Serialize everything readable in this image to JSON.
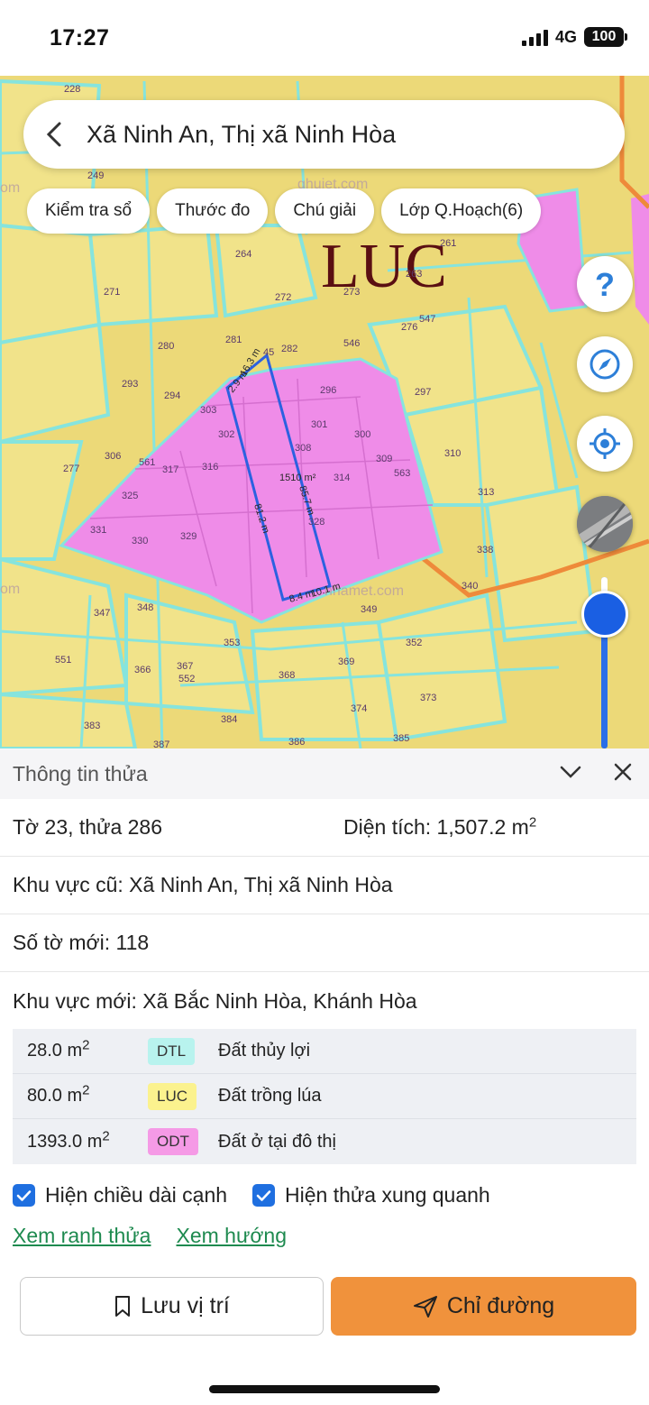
{
  "status_bar": {
    "time": "17:27",
    "network": "4G",
    "battery": "100"
  },
  "search": {
    "title": "Xã Ninh An, Thị xã Ninh Hòa"
  },
  "chips": [
    "Kiểm tra sổ",
    "Thước đo",
    "Chú giải",
    "Lớp Q.Hoạch(6)"
  ],
  "map": {
    "zone_label": "LUC",
    "watermarks": [
      "om",
      "ghujet.com",
      "om",
      "nhamet.com"
    ],
    "parcel_numbers": [
      {
        "n": "228"
      },
      {
        "n": "249"
      },
      {
        "n": "264"
      },
      {
        "n": "271"
      },
      {
        "n": "272"
      },
      {
        "n": "273"
      },
      {
        "n": "261"
      },
      {
        "n": "263"
      },
      {
        "n": "547"
      },
      {
        "n": "276"
      },
      {
        "n": "280"
      },
      {
        "n": "281"
      },
      {
        "n": "45"
      },
      {
        "n": "282"
      },
      {
        "n": "546"
      },
      {
        "n": "293"
      },
      {
        "n": "294"
      },
      {
        "n": "296"
      },
      {
        "n": "297"
      },
      {
        "n": "303"
      },
      {
        "n": "301"
      },
      {
        "n": "302"
      },
      {
        "n": "300"
      },
      {
        "n": "308"
      },
      {
        "n": "306"
      },
      {
        "n": "561"
      },
      {
        "n": "317"
      },
      {
        "n": "316"
      },
      {
        "n": "309"
      },
      {
        "n": "310"
      },
      {
        "n": "277"
      },
      {
        "n": "314"
      },
      {
        "n": "563"
      },
      {
        "n": "325"
      },
      {
        "n": "313"
      },
      {
        "n": "331"
      },
      {
        "n": "330"
      },
      {
        "n": "329"
      },
      {
        "n": "328"
      },
      {
        "n": "338"
      },
      {
        "n": "340"
      },
      {
        "n": "347"
      },
      {
        "n": "348"
      },
      {
        "n": "349"
      },
      {
        "n": "353"
      },
      {
        "n": "352"
      },
      {
        "n": "551"
      },
      {
        "n": "366"
      },
      {
        "n": "367"
      },
      {
        "n": "552"
      },
      {
        "n": "368"
      },
      {
        "n": "369"
      },
      {
        "n": "373"
      },
      {
        "n": "374"
      },
      {
        "n": "383"
      },
      {
        "n": "384"
      },
      {
        "n": "387"
      },
      {
        "n": "386"
      },
      {
        "n": "385"
      }
    ],
    "measurements": [
      "2.9 m",
      "16.3 m",
      "1510 m²",
      "81.2 m",
      "85.7 m",
      "8.4 m",
      "10.1 m"
    ]
  },
  "panel": {
    "title": "Thông tin thửa",
    "sheet_parcel": "Tờ 23, thửa 286",
    "area_label": "Diện tích: 1,507.2 m",
    "area_unit_sup": "2",
    "old_area": "Khu vực cũ: Xã Ninh An, Thị xã Ninh Hòa",
    "new_sheet": "Số tờ mới: 118",
    "new_area": "Khu vực mới: Xã Bắc Ninh Hòa, Khánh Hòa",
    "land_uses": [
      {
        "area": "28.0 m",
        "sup": "2",
        "code": "DTL",
        "name": "Đất thủy lợi",
        "color": "#b8f3ee"
      },
      {
        "area": "80.0 m",
        "sup": "2",
        "code": "LUC",
        "name": "Đất trồng lúa",
        "color": "#fbf28e"
      },
      {
        "area": "1393.0 m",
        "sup": "2",
        "code": "ODT",
        "name": "Đất ở tại đô thị",
        "color": "#f59ae6"
      }
    ],
    "check_edge_length": "Hiện chiều dài cạnh",
    "check_neighbors": "Hiện thửa xung quanh",
    "link_boundary": "Xem ranh thửa",
    "link_direction": "Xem hướng",
    "btn_save": "Lưu vị trí",
    "btn_route": "Chỉ đường"
  },
  "colors": {
    "accent_orange": "#f0923c",
    "link_green": "#1e8a4f",
    "check_blue": "#1f6fe0",
    "zone_pink": "#ef8ce8",
    "zone_yellow": "#ecd978",
    "boundary_cyan": "#7fe0e0"
  }
}
